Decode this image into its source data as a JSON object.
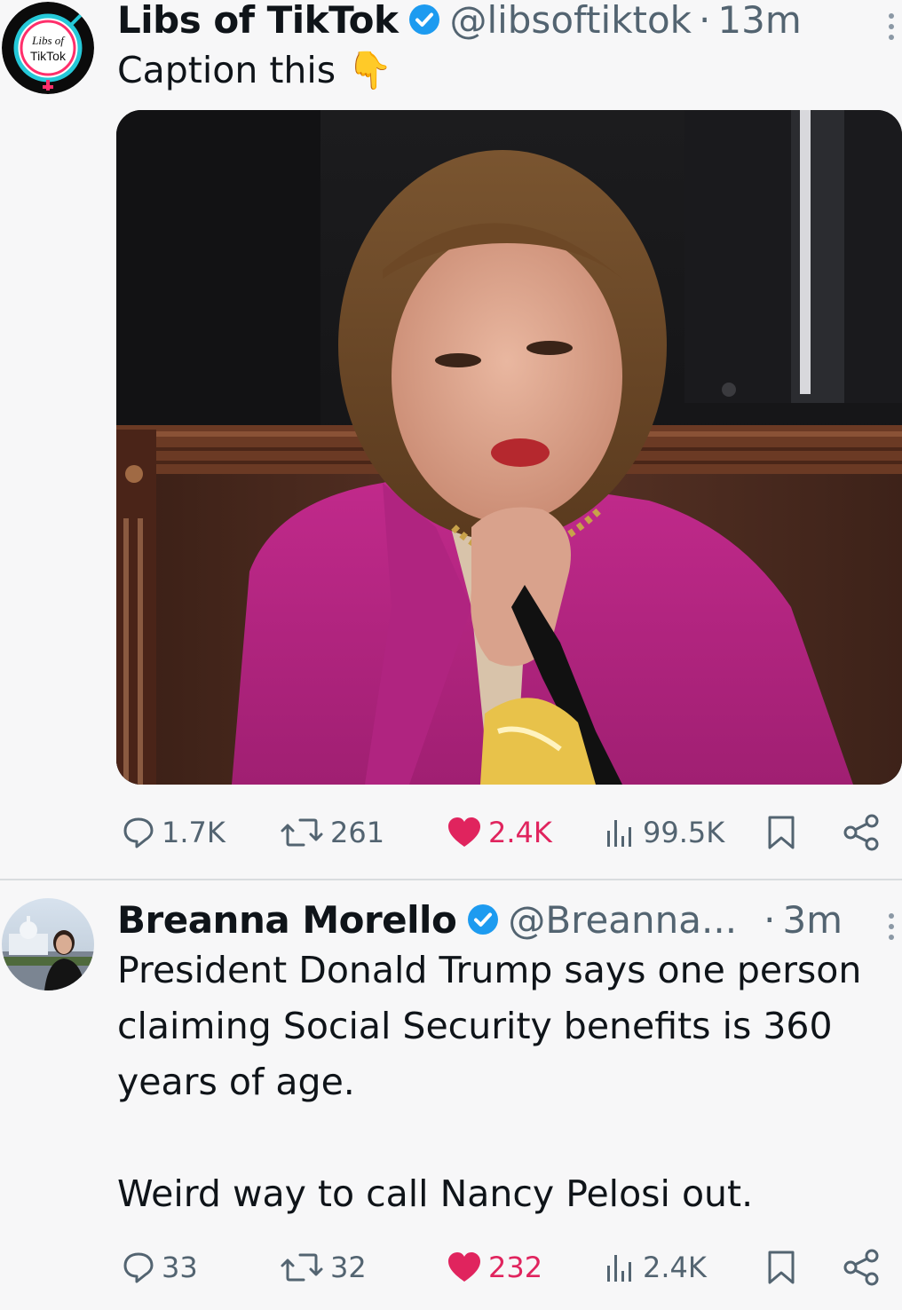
{
  "tweets": [
    {
      "author": "Libs of TikTok",
      "handle": "@libsoftiktok",
      "separator": "·",
      "time": "13m",
      "text": "Caption this 👇",
      "avatar_text": [
        "Libs of",
        "TikTok"
      ],
      "media": "photo",
      "stats": {
        "replies": "1.7K",
        "retweets": "261",
        "likes": "2.4K",
        "views": "99.5K"
      }
    },
    {
      "author": "Breanna Morello",
      "handle": "@Breanna...",
      "separator": "·",
      "time": "3m",
      "text": "President Donald Trump says one person\nclaiming Social Security benefits is 360\nyears of age.\n\nWeird way to call Nancy Pelosi out.",
      "stats": {
        "replies": "33",
        "retweets": "32",
        "likes": "232",
        "views": "2.4K"
      }
    }
  ],
  "colors": {
    "like": "#e0245e",
    "verified": "#1d9bf0",
    "muted": "#536471"
  },
  "icons": [
    "reply-icon",
    "retweet-icon",
    "heart-icon",
    "views-icon",
    "bookmark-icon",
    "share-icon",
    "verified-icon",
    "more-icon"
  ]
}
